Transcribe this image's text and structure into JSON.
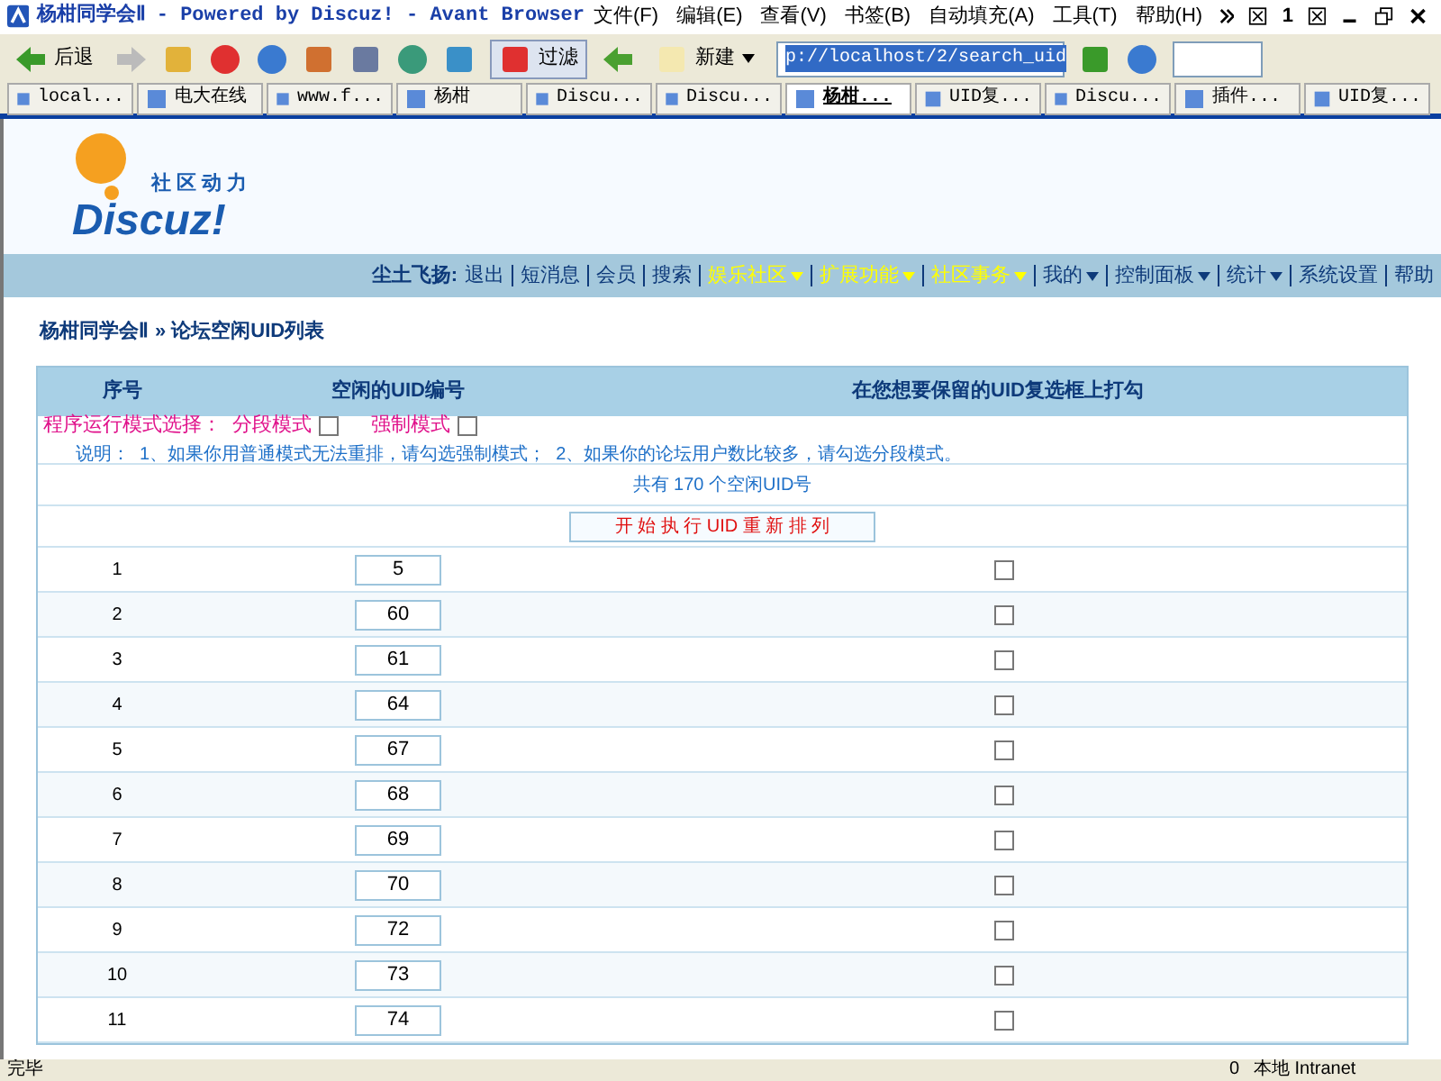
{
  "window": {
    "title": "杨柑同学会Ⅱ - Powered by Discuz! - Avant Browser",
    "menu": [
      "文件(F)",
      "编辑(E)",
      "查看(V)",
      "书签(B)",
      "自动填充(A)",
      "工具(T)",
      "帮助(H)"
    ],
    "window_count": "1"
  },
  "toolbar": {
    "back": "后退",
    "filter": "过滤",
    "filter_on": true,
    "new": "新建",
    "address": "p://localhost/2/search_uid"
  },
  "tabs": [
    {
      "label": "local...",
      "selected": false
    },
    {
      "label": "电大在线",
      "selected": false
    },
    {
      "label": "www.f...",
      "selected": false
    },
    {
      "label": "杨柑",
      "selected": false
    },
    {
      "label": "Discu...",
      "selected": false
    },
    {
      "label": "Discu...",
      "selected": false
    },
    {
      "label": "杨柑...",
      "selected": true
    },
    {
      "label": "UID复...",
      "selected": false
    },
    {
      "label": "Discu...",
      "selected": false
    },
    {
      "label": "插件...",
      "selected": false
    },
    {
      "label": "UID复...",
      "selected": false
    }
  ],
  "logo": {
    "tagline": "社区动力",
    "wordmark": "Discuz!"
  },
  "nav": {
    "user": "尘土飞扬:",
    "items": [
      {
        "label": "退出",
        "highlighted": false,
        "dropdown": false
      },
      {
        "label": "短消息",
        "highlighted": false,
        "dropdown": false
      },
      {
        "label": "会员",
        "highlighted": false,
        "dropdown": false
      },
      {
        "label": "搜索",
        "highlighted": false,
        "dropdown": false
      },
      {
        "label": "娱乐社区",
        "highlighted": true,
        "dropdown": true
      },
      {
        "label": "扩展功能",
        "highlighted": true,
        "dropdown": true
      },
      {
        "label": "社区事务",
        "highlighted": true,
        "dropdown": true
      },
      {
        "label": "我的",
        "highlighted": false,
        "dropdown": true
      },
      {
        "label": "控制面板",
        "highlighted": false,
        "dropdown": true
      },
      {
        "label": "统计",
        "highlighted": false,
        "dropdown": true
      },
      {
        "label": "系统设置",
        "highlighted": false,
        "dropdown": false
      },
      {
        "label": "帮助",
        "highlighted": false,
        "dropdown": false
      }
    ]
  },
  "breadcrumb": [
    "杨柑同学会Ⅱ",
    "» 论坛空闲UID列表"
  ],
  "table": {
    "columns": [
      "序号",
      "空闲的UID编号",
      "在您想要保留的UID复选框上打勾"
    ],
    "mode_label": "程序运行模式选择：",
    "modes": [
      {
        "label": "分段模式",
        "checked": false
      },
      {
        "label": "强制模式",
        "checked": false
      }
    ],
    "note": "说明：  1、如果你用普通模式无法重排，请勾选强制模式；  2、如果你的论坛用户数比较多，请勾选分段模式。",
    "count": "共有 170 个空闲UID号",
    "run_button": "开 始 执 行 UID 重 新 排 列",
    "rows": [
      {
        "index": "1",
        "uid": "5",
        "checked": false
      },
      {
        "index": "2",
        "uid": "60",
        "checked": false
      },
      {
        "index": "3",
        "uid": "61",
        "checked": false
      },
      {
        "index": "4",
        "uid": "64",
        "checked": false
      },
      {
        "index": "5",
        "uid": "67",
        "checked": false
      },
      {
        "index": "6",
        "uid": "68",
        "checked": false
      },
      {
        "index": "7",
        "uid": "69",
        "checked": false
      },
      {
        "index": "8",
        "uid": "70",
        "checked": false
      },
      {
        "index": "9",
        "uid": "72",
        "checked": false
      },
      {
        "index": "10",
        "uid": "73",
        "checked": false
      },
      {
        "index": "11",
        "uid": "74",
        "checked": false
      }
    ]
  },
  "status_bar": {
    "text": "完毕",
    "count": "0",
    "zone": "本地 Intranet"
  }
}
